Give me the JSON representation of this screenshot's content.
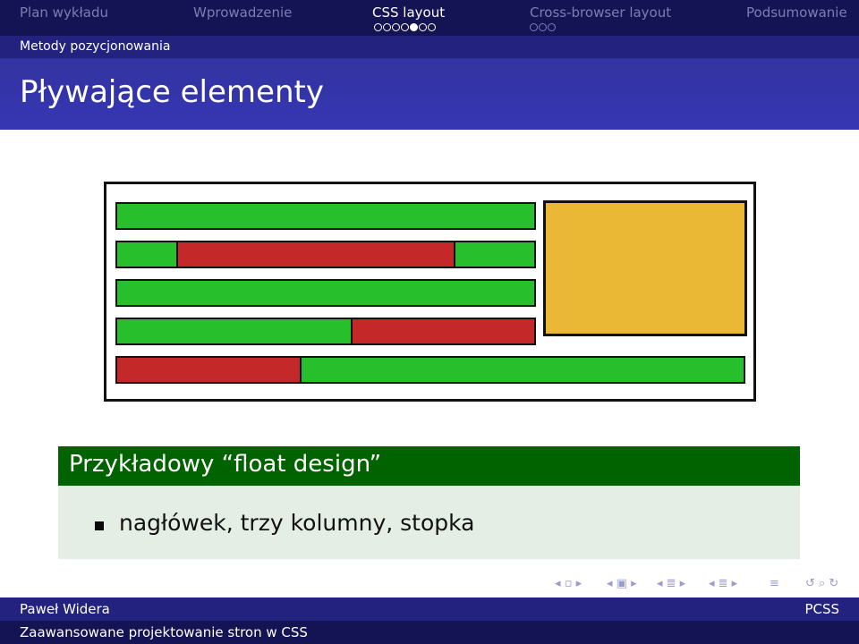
{
  "nav": {
    "sections": [
      "Plan wykładu",
      "Wprowadzenie",
      "CSS layout",
      "Cross-browser layout",
      "Podsumowanie"
    ],
    "active_index": 2
  },
  "subsection": "Metody pozycjonowania",
  "frame_title": "Pływające elementy",
  "diagram": {
    "colors": {
      "green": "#27c02c",
      "red": "#c42828",
      "yellow": "#ebb835",
      "border": "#111111"
    }
  },
  "block": {
    "title": "Przykładowy “float design”",
    "items": [
      "nagłówek, trzy kolumny, stopka"
    ]
  },
  "nav_symbols": [
    "slide-nav-icon",
    "frame-nav-icon",
    "subsection-nav-icon",
    "section-nav-icon",
    "align-icon",
    "search-icon"
  ],
  "footer": {
    "author": "Paweł Widera",
    "short_title": "PCSS",
    "title": "Zaawansowane projektowanie stron w CSS"
  }
}
